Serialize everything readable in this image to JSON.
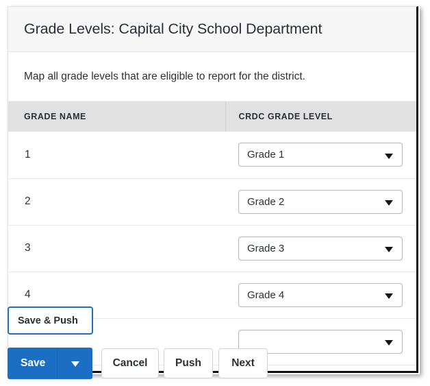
{
  "window": {
    "title": "Grade Levels: Capital City School Department",
    "description": "Map all grade levels that are eligible to report for the district."
  },
  "table": {
    "columns": [
      "GRADE NAME",
      "CRDC GRADE LEVEL"
    ],
    "rows": [
      {
        "grade_name": "1",
        "crdc_grade_level": "Grade 1"
      },
      {
        "grade_name": "2",
        "crdc_grade_level": "Grade 2"
      },
      {
        "grade_name": "3",
        "crdc_grade_level": "Grade 3"
      },
      {
        "grade_name": "4",
        "crdc_grade_level": "Grade 4"
      },
      {
        "grade_name": "",
        "crdc_grade_level": ""
      }
    ]
  },
  "actions": {
    "save_label": "Save",
    "cancel_label": "Cancel",
    "push_label": "Push",
    "next_label": "Next",
    "save_menu": {
      "items": [
        {
          "label": "Save & Push"
        }
      ]
    }
  },
  "colors": {
    "primary": "#1b6ec2",
    "title_bar": "#f7f7f7",
    "table_header": "#e1e1e1",
    "text": "#2b3038",
    "border": "#d2d2d2"
  },
  "icons": {
    "select_caret": "chevron-down-icon",
    "save_caret": "chevron-down-icon"
  }
}
